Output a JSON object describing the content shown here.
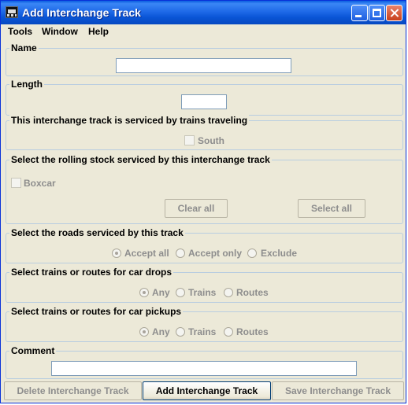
{
  "window": {
    "title": "Add Interchange Track"
  },
  "menu": [
    "Tools",
    "Window",
    "Help"
  ],
  "name_panel": {
    "title": "Name",
    "value": ""
  },
  "length_panel": {
    "title": "Length",
    "value": ""
  },
  "direction_panel": {
    "title": "This interchange track is serviced by trains traveling",
    "option": "South",
    "checked": false
  },
  "rolling_stock_panel": {
    "title": "Select the rolling stock serviced by this interchange track",
    "option": "Boxcar",
    "checked": false,
    "clear_label": "Clear all",
    "select_label": "Select all"
  },
  "roads_panel": {
    "title": "Select the roads serviced by this track",
    "options": [
      "Accept all",
      "Accept only",
      "Exclude"
    ],
    "selected": 0
  },
  "drops_panel": {
    "title": "Select trains or routes for car drops",
    "options": [
      "Any",
      "Trains",
      "Routes"
    ],
    "selected": 0
  },
  "pickups_panel": {
    "title": "Select trains or routes for car pickups",
    "options": [
      "Any",
      "Trains",
      "Routes"
    ],
    "selected": 0
  },
  "comment_panel": {
    "title": "Comment",
    "value": ""
  },
  "buttons": {
    "delete": "Delete Interchange Track",
    "add": "Add Interchange Track",
    "save": "Save Interchange Track"
  },
  "colors": {
    "titlebar": "#0a55d6",
    "disabled_text": "#8d8d8d",
    "panel_border": "#b8cde0",
    "background": "#ece9d8"
  }
}
